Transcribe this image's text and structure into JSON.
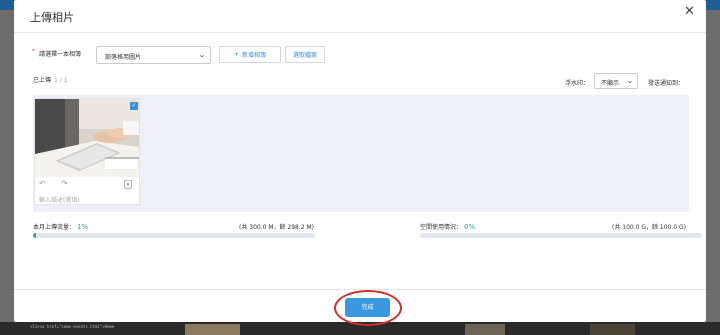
{
  "modal": {
    "title": "上傳相片",
    "close": "✕"
  },
  "form": {
    "required_mark": "*",
    "album_label": "請選擇一本相簿",
    "album_value": "部落格用圖片",
    "new_album": "新增相簿",
    "new_album_icon": "+",
    "pick_files": "選取檔案"
  },
  "status": {
    "uploaded_label": "已上傳",
    "uploaded_count": "1 / 1",
    "watermark_label": "浮水印：",
    "watermark_value": "不顯示",
    "send_notice": "發送通知到："
  },
  "photo": {
    "selected": true,
    "caption_placeholder": "輸入描述(選填)"
  },
  "quota": {
    "monthly_label": "本月上傳流量：",
    "monthly_pct": "1%",
    "monthly_fraction": 0.01,
    "monthly_total": "(共 300.0 M，餘 298.2 M)",
    "space_label": "空間使用情況：",
    "space_pct": "0%",
    "space_fraction": 0.0,
    "space_total": "(共 100.0 G，餘 100.0 G)"
  },
  "footer": {
    "done": "完成"
  },
  "background": {
    "code_snippet": "<li><a href=\"some-events.html\">Home"
  },
  "colors": {
    "accent": "#3a98e0",
    "progress": "#3aa88a",
    "highlight_ring": "#d32f2f"
  },
  "icons": {
    "close": "close-icon",
    "plus": "plus-icon",
    "rotate_left": "rotate-left-icon",
    "rotate_right": "rotate-right-icon",
    "check": "check-icon",
    "chevron": "chevron-down-icon"
  }
}
